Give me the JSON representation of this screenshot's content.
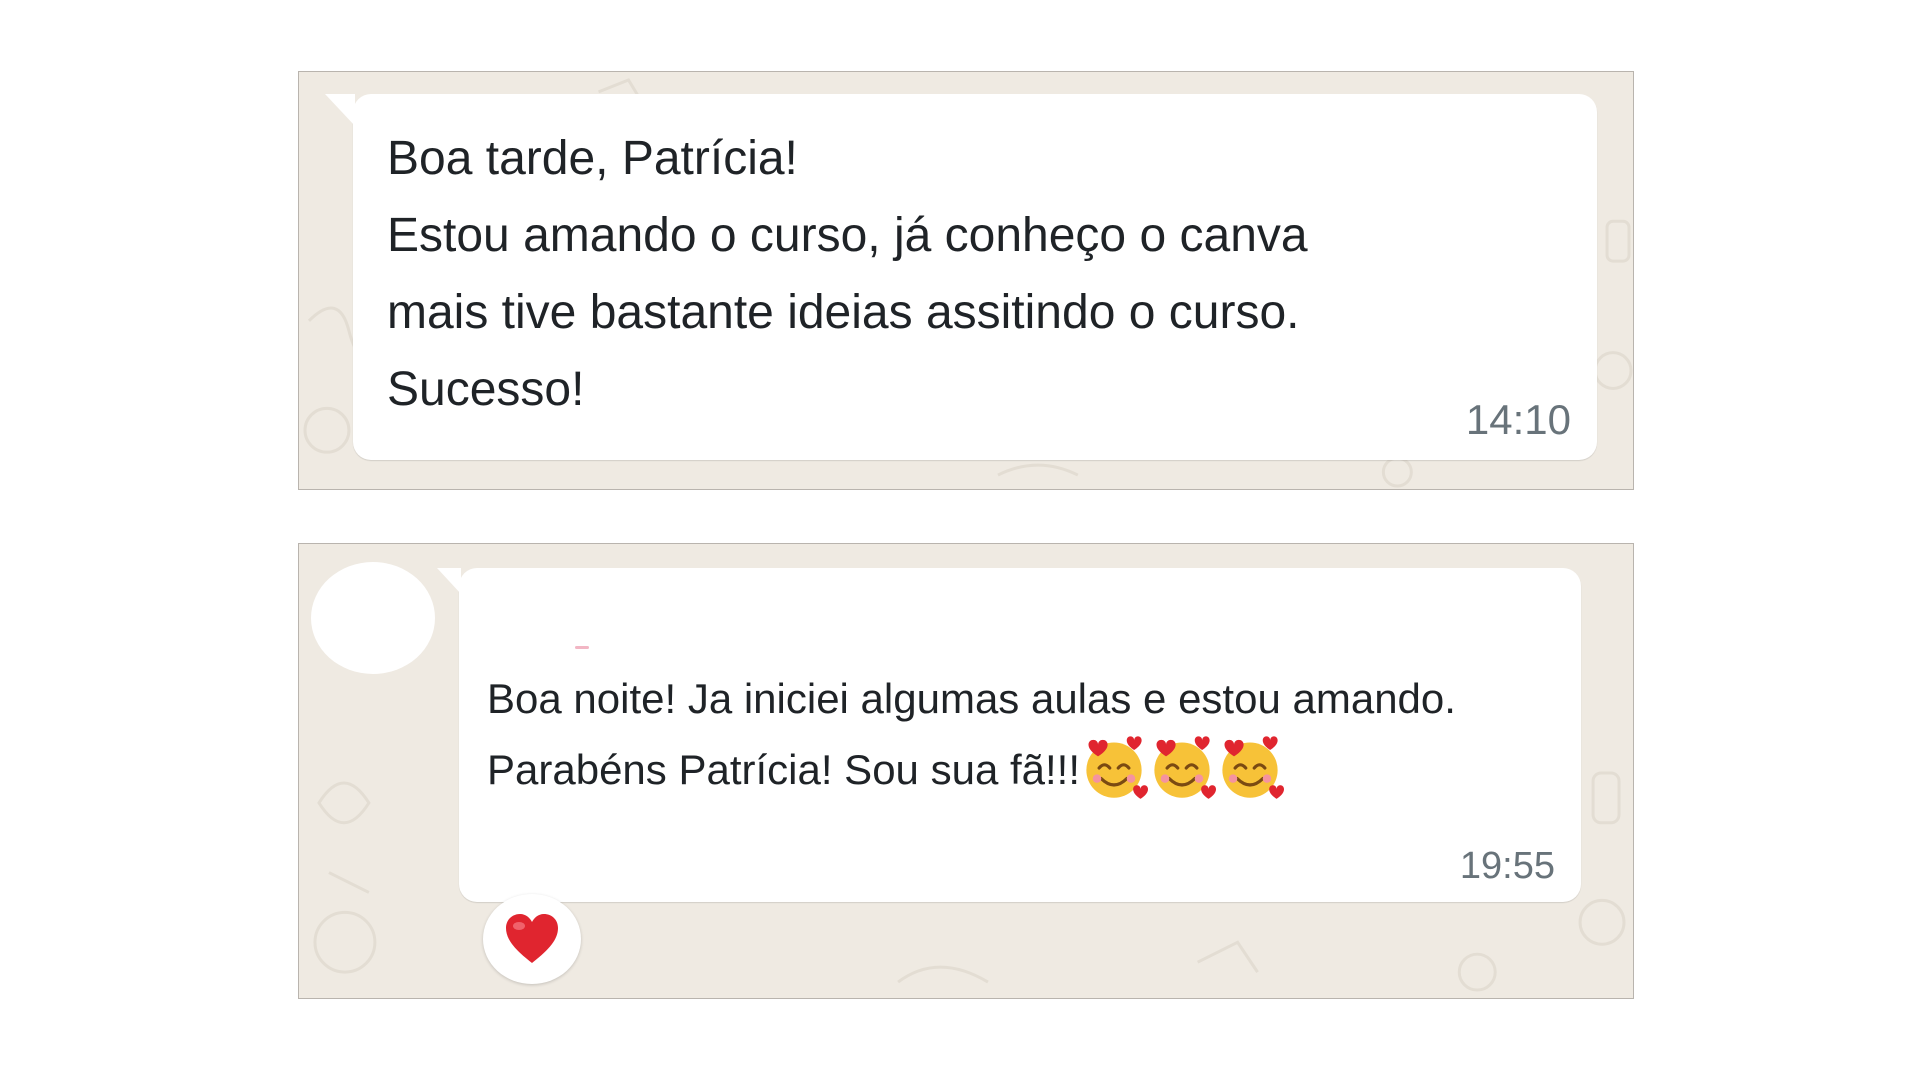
{
  "messages": [
    {
      "text": "Boa tarde, Patrícia!\nEstou amando o curso, já conheço o canva\nmais tive bastante  ideias assitindo o curso.\nSucesso!",
      "time": "14:10"
    },
    {
      "text": "Boa noite! Ja iniciei algumas aulas e estou amando.  Parabéns Patrícia! Sou sua fã!!!",
      "emoji": "smiling-face-with-hearts-icon",
      "emoji_count": 3,
      "time": "19:55",
      "reaction": "red-heart-icon"
    }
  ],
  "colors": {
    "chat_background": "#efeae2",
    "bubble": "#ffffff",
    "text": "#1f2327",
    "timestamp": "#68737a",
    "heart": "#e0252f"
  }
}
